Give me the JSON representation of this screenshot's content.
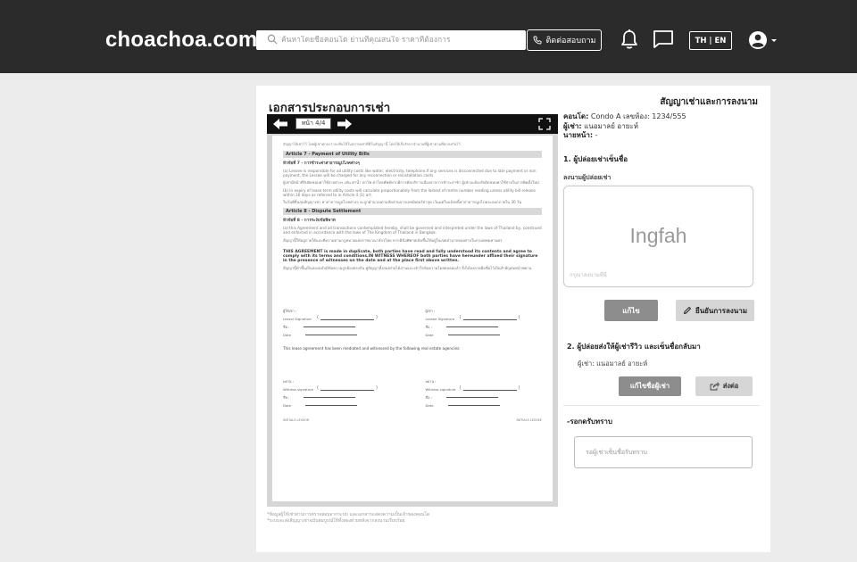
{
  "header": {
    "logo": "choachoa.com",
    "search_placeholder": "ค้นหาโดยชื่อคอนโด ย่านที่คุณสนใจ ราคาที่ต้องการ",
    "contact_label": "ติดต่อสอบถาม",
    "lang_label": "TH | EN"
  },
  "page": {
    "doc_title": "เอกสารประกอบการเช่า",
    "right_title": "สัญญาเช่าและการลงนาม"
  },
  "viewer": {
    "page_indicator": "หน้า 4/4",
    "top_note": "สัญญาให้เช่าไว้ โดยผู้เช่าตกลงว่าจะคืนให้ในสภาพเช่าที่ดีในสัญญานี้ โดยให้เก็บรักษาจำนวนที่ผู้เช่าตามที่ตกลงกันไว้",
    "article7_head": "Article 7 - Payment of Utility Bills",
    "article7_sub": "หัวข้อที่ 7 - การชำระค่าสาธารณูปโภคต่างๆ",
    "article7_a": "(a) Lessee is responsible for all utility costs like water, electricity, telephone.If any services is disconnected due to late payment or non payment, the Lessee will be charged for any reconnection or reinstallation costs.",
    "article7_a_th": "ผู้เช่ามีหน้าที่รับผิดชอบค่าใช้จ่ายต่างๆ เช่น ค่าน้ำ ค่าไฟ ค่าโทรศัพท์หากมีการตัดบริการเนื่องจากการชำระล่าช้า ผู้เช่าจะต้องรับผิดชอบค่าใช้จ่ายในการติดตั้งใหม่",
    "article7_b": "(b) In expiry of lease term utility costs will calculate proportionately from the lastest of metre number reading unless utility bill release within 30 days as referred to in Article 4 (1) art.",
    "article7_b_th": "ในวันที่สิ้นสุดสัญญาเช่า ค่าสาธารณูปโภคต่างๆ จะถูกคำนวณตามสัดส่วนจากเลขมิเตอร์ล่าสุด เว้นแต่ใบแจ้งหนี้ค่าสาธารณูปโภคจะออกภายใน 30 วัน",
    "article8_head": "Article 8 - Dispute Settlement",
    "article8_sub": "หัวข้อที่ 8 - การระงับข้อพิพาท",
    "article8_a": "(a) this Agreement and all transactions contemplated hereby, shall be governed and interpreted under the laws of Thailand by, construed and enforced in accordance with the laws of The Kingdom of Thailand in Bangkok.",
    "article8_a_th": "สัญญานี้ให้อยู่ภายใต้และตีความตามกฎหมายแห่งราชอาณาจักรไทย หากมีข้อพิพาทเกิดขึ้นให้อยู่ในเขตอำนาจของศาลในกรุงเทพมหานคร",
    "agreement": "THIS AGREEMENT is made in duplicate, both parties have read and fully understood its contents and agree to comply with its terms and conditions.IN WITNESS WHEREOF both parties have hereunder affixed their signature in the presence of witnesses on the date and at the place first above written.",
    "agreement_th": "สัญญานี้ทำขึ้นเป็นสองฉบับมีข้อความถูกต้องตรงกัน คู่สัญญาทั้งสองฝ่ายได้อ่านและเข้าใจข้อความโดยตลอดแล้ว จึงได้ลงลายมือชื่อไว้เป็นสำคัญต่อหน้าพยาน",
    "lessor_th": "ผู้ให้เช่า :",
    "lessor_sig": "Lessor Signature",
    "lessee_th": "ผู้เช่า :",
    "lessee_sig": "Lessee Signature",
    "name_label": "ชื่อ :",
    "date_label": "Date",
    "mediated": "This lease agreement has been mediated and witnessed by the following real estate agencies:",
    "witness_th": "พยาน :",
    "witness_sig": "Witness signature",
    "footer_left": "INITIALS LESSOR",
    "footer_right": "INITIALS LESSEE"
  },
  "footnotes": {
    "line1": "*ข้อมูลผู้ให้เช่าผ่านการตรวจสอบจากระบบ และเอกสารแสดงความเป็นเจ้าของคอนโด",
    "line2": "*ระบบจะส่งสัญญาเช่าฉบับสมบูรณ์ให้ทั้งสองฝ่ายหลังจากลงนามเรียบร้อย"
  },
  "details": {
    "condo_label": "คอนโด:",
    "condo_value": "Condo A เลขห้อง: 1234/555",
    "tenant_label": "ผู้เช่า:",
    "tenant_value": "แนอมาลย์ อายะห์",
    "agent_label": "นายหน้า:",
    "agent_value": "-"
  },
  "step1": {
    "title": "1. ผู้ปล่อยเช่าเซ็นชื่อ",
    "sign_label": "ลงนามผู้ปล่อยเช่า",
    "signature": "Ingfah",
    "sign_hint": "กรุณาลงนามที่นี่",
    "edit_label": "แก้ไข",
    "confirm_label": "ยืนยันการลงนาม"
  },
  "step2": {
    "title": "2. ผู้ปล่อยส่งให้ผู้เช่ารีวิว และเซ็นชื่อกลับมา",
    "tenant_line": "ผู้เช่า: แนอมาลย์ อายะห์",
    "edit_tenant_label": "แก้ไขชื่อผู้เช่า",
    "send_label": "ส่งต่อ"
  },
  "step3": {
    "title": "-รอกดรับทราบ",
    "ack_text": "รอผู้เช่าเซ็นชื่อรับทราบ"
  }
}
